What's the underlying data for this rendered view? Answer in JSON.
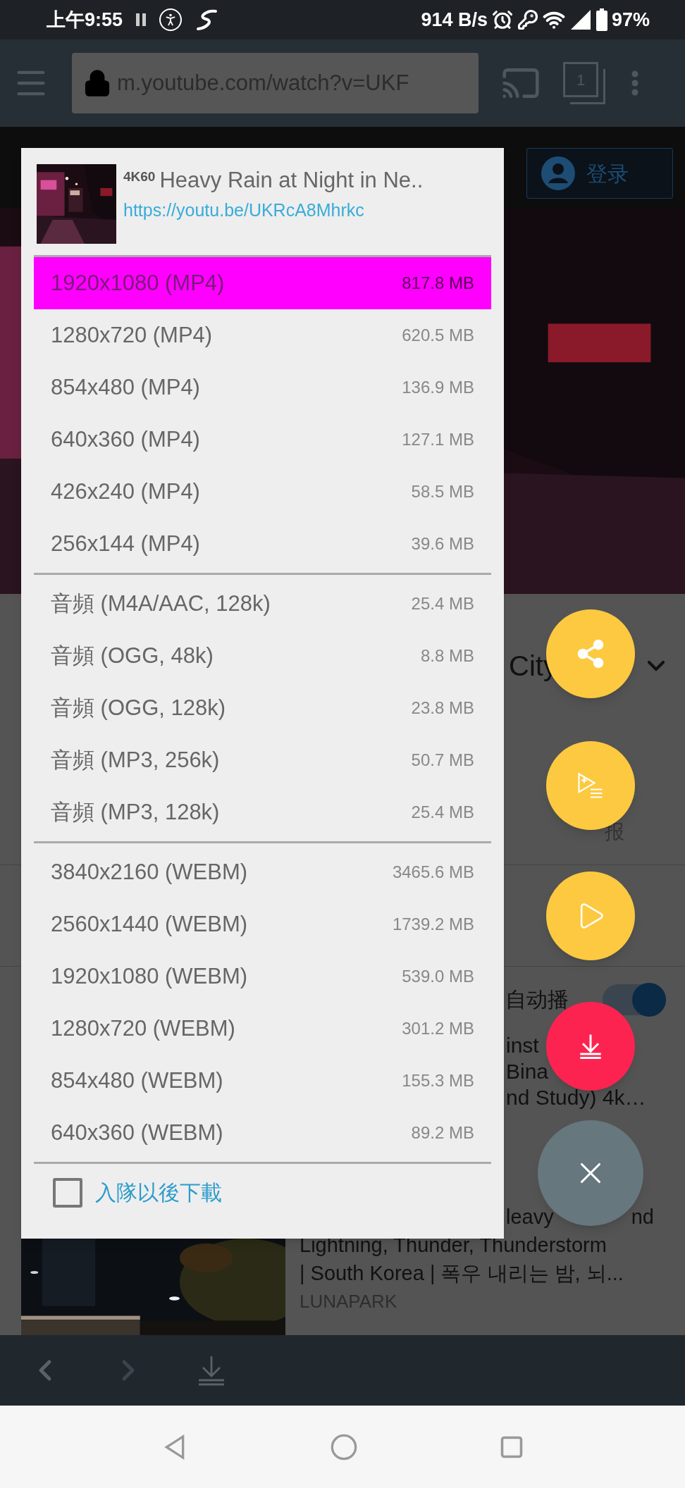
{
  "status_bar": {
    "time": "上午9:55",
    "speed": "914 B/s",
    "battery": "97%"
  },
  "toolbar": {
    "url": "m.youtube.com/watch?v=UKF",
    "tab_count": "1"
  },
  "page": {
    "sign_in": "登录",
    "title_fragment": "City",
    "report": "报",
    "autoplay": {
      "label": "自动播",
      "on": true
    },
    "recommendation_fragments": [
      "inst",
      "Bina",
      "nd Study) 4k…"
    ],
    "recommendation": {
      "title_fragments": [
        "leavy",
        "nd"
      ],
      "lines": [
        "Lightning, Thunder, Thunderstorm",
        "| South Korea | 폭우 내리는 밤, 뇌..."
      ],
      "channel": "LUNAPARK"
    }
  },
  "dialog": {
    "quality_badge": "4K60",
    "title": "Heavy Rain at Night in Ne..",
    "link": "https://youtu.be/UKRcA8Mhrkc",
    "format_groups": [
      {
        "items": [
          {
            "label": "1920x1080 (MP4)",
            "size": "817.8 MB",
            "selected": true
          },
          {
            "label": "1280x720 (MP4)",
            "size": "620.5 MB",
            "selected": false
          },
          {
            "label": "854x480 (MP4)",
            "size": "136.9 MB",
            "selected": false
          },
          {
            "label": "640x360 (MP4)",
            "size": "127.1 MB",
            "selected": false
          },
          {
            "label": "426x240 (MP4)",
            "size": "58.5 MB",
            "selected": false
          },
          {
            "label": "256x144 (MP4)",
            "size": "39.6 MB",
            "selected": false
          }
        ]
      },
      {
        "items": [
          {
            "label": "音頻 (M4A/AAC, 128k)",
            "size": "25.4 MB",
            "selected": false
          },
          {
            "label": "音頻 (OGG, 48k)",
            "size": "8.8 MB",
            "selected": false
          },
          {
            "label": "音頻 (OGG, 128k)",
            "size": "23.8 MB",
            "selected": false
          },
          {
            "label": "音頻 (MP3, 256k)",
            "size": "50.7 MB",
            "selected": false
          },
          {
            "label": "音頻 (MP3, 128k)",
            "size": "25.4 MB",
            "selected": false
          }
        ]
      },
      {
        "items": [
          {
            "label": "3840x2160 (WEBM)",
            "size": "3465.6 MB",
            "selected": false
          },
          {
            "label": "2560x1440 (WEBM)",
            "size": "1739.2 MB",
            "selected": false
          },
          {
            "label": "1920x1080 (WEBM)",
            "size": "539.0 MB",
            "selected": false
          },
          {
            "label": "1280x720 (WEBM)",
            "size": "301.2 MB",
            "selected": false
          },
          {
            "label": "854x480 (WEBM)",
            "size": "155.3 MB",
            "selected": false
          },
          {
            "label": "640x360 (WEBM)",
            "size": "89.2 MB",
            "selected": false
          }
        ]
      }
    ],
    "queue_option": {
      "label": "入隊以後下載",
      "checked": false
    }
  },
  "fabs": [
    {
      "kind": "share"
    },
    {
      "kind": "playlist"
    },
    {
      "kind": "play"
    },
    {
      "kind": "download"
    },
    {
      "kind": "close"
    }
  ]
}
